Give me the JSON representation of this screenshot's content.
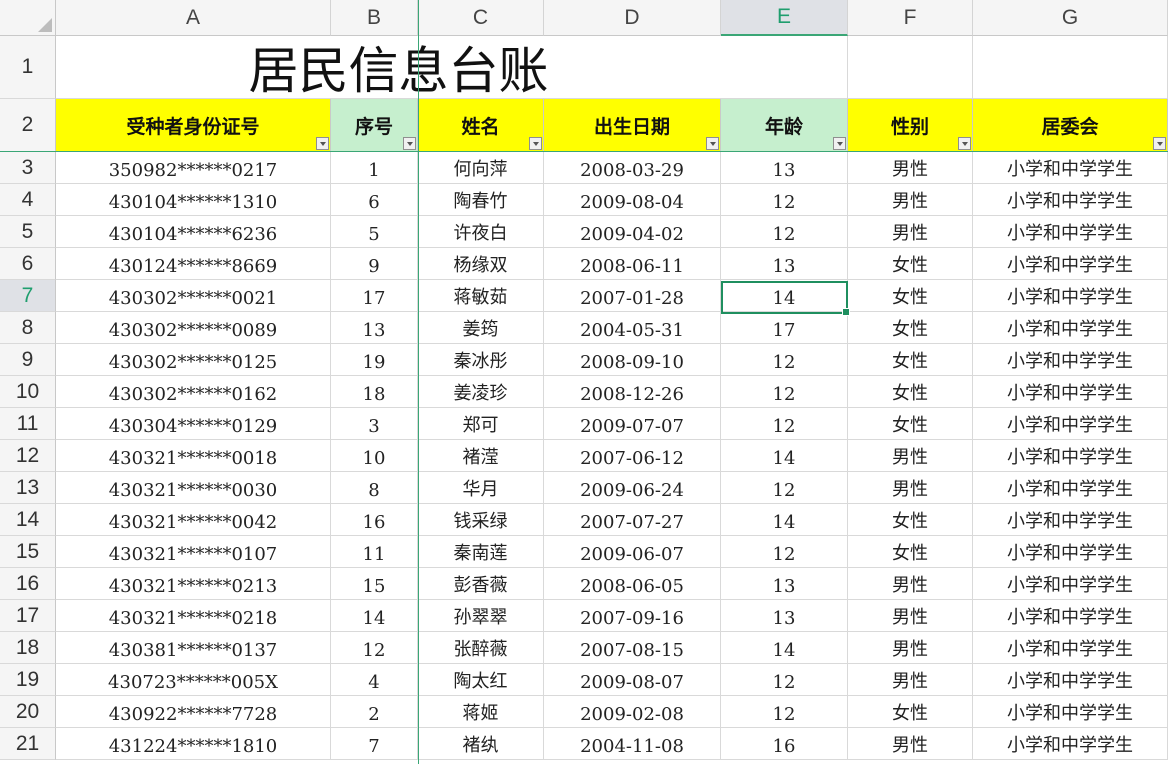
{
  "columns": [
    "A",
    "B",
    "C",
    "D",
    "E",
    "F",
    "G"
  ],
  "active_column": "E",
  "active_row": "7",
  "title": "居民信息台账",
  "headers": [
    "受种者身份证号",
    "序号",
    "姓名",
    "出生日期",
    "年龄",
    "性别",
    "居委会"
  ],
  "header_colors": {
    "yellow": "#ffff00",
    "green": "#c6efce"
  },
  "row_numbers": [
    "1",
    "2",
    "3",
    "4",
    "5",
    "6",
    "7",
    "8",
    "9",
    "10",
    "11",
    "12",
    "13",
    "14",
    "15",
    "16",
    "17",
    "18",
    "19",
    "20",
    "21"
  ],
  "rows": [
    [
      "350982******0217",
      "1",
      "何向萍",
      "2008-03-29",
      "13",
      "男性",
      "小学和中学学生"
    ],
    [
      "430104******1310",
      "6",
      "陶春竹",
      "2009-08-04",
      "12",
      "男性",
      "小学和中学学生"
    ],
    [
      "430104******6236",
      "5",
      "许夜白",
      "2009-04-02",
      "12",
      "男性",
      "小学和中学学生"
    ],
    [
      "430124******8669",
      "9",
      "杨缘双",
      "2008-06-11",
      "13",
      "女性",
      "小学和中学学生"
    ],
    [
      "430302******0021",
      "17",
      "蒋敏茹",
      "2007-01-28",
      "14",
      "女性",
      "小学和中学学生"
    ],
    [
      "430302******0089",
      "13",
      "姜筠",
      "2004-05-31",
      "17",
      "女性",
      "小学和中学学生"
    ],
    [
      "430302******0125",
      "19",
      "秦冰彤",
      "2008-09-10",
      "12",
      "女性",
      "小学和中学学生"
    ],
    [
      "430302******0162",
      "18",
      "姜凌珍",
      "2008-12-26",
      "12",
      "女性",
      "小学和中学学生"
    ],
    [
      "430304******0129",
      "3",
      "郑可",
      "2009-07-07",
      "12",
      "女性",
      "小学和中学学生"
    ],
    [
      "430321******0018",
      "10",
      "褚滢",
      "2007-06-12",
      "14",
      "男性",
      "小学和中学学生"
    ],
    [
      "430321******0030",
      "8",
      "华月",
      "2009-06-24",
      "12",
      "男性",
      "小学和中学学生"
    ],
    [
      "430321******0042",
      "16",
      "钱采绿",
      "2007-07-27",
      "14",
      "女性",
      "小学和中学学生"
    ],
    [
      "430321******0107",
      "11",
      "秦南莲",
      "2009-06-07",
      "12",
      "女性",
      "小学和中学学生"
    ],
    [
      "430321******0213",
      "15",
      "彭香薇",
      "2008-06-05",
      "13",
      "男性",
      "小学和中学学生"
    ],
    [
      "430321******0218",
      "14",
      "孙翠翠",
      "2007-09-16",
      "13",
      "男性",
      "小学和中学学生"
    ],
    [
      "430381******0137",
      "12",
      "张醉薇",
      "2007-08-15",
      "14",
      "男性",
      "小学和中学学生"
    ],
    [
      "430723******005X",
      "4",
      "陶太红",
      "2009-08-07",
      "12",
      "男性",
      "小学和中学学生"
    ],
    [
      "430922******7728",
      "2",
      "蒋姬",
      "2009-02-08",
      "12",
      "女性",
      "小学和中学学生"
    ],
    [
      "431224******1810",
      "7",
      "褚纨",
      "2004-11-08",
      "16",
      "男性",
      "小学和中学学生"
    ]
  ]
}
